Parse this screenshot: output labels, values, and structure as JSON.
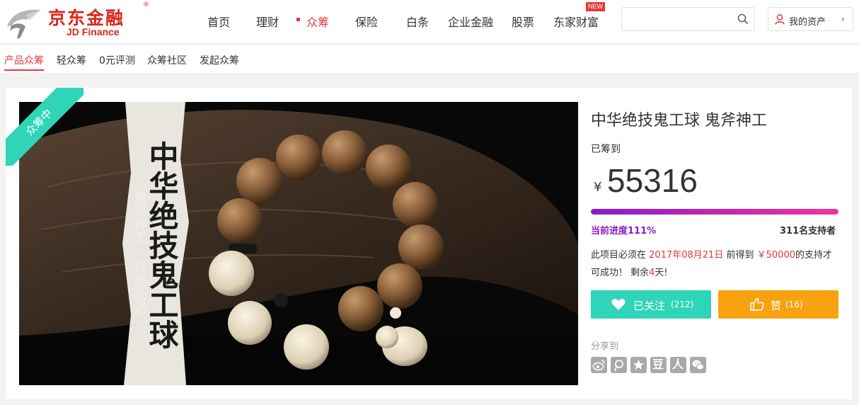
{
  "header": {
    "logo_cn": "京东金融",
    "logo_en": "JD Finance",
    "logo_reg": "®",
    "nav": [
      "首页",
      "理财",
      "众筹",
      "保险",
      "白条",
      "企业金融",
      "股票",
      "东家财富"
    ],
    "active_nav": "众筹",
    "new_badge": "NEW",
    "search": {
      "placeholder": "",
      "value": ""
    },
    "assets_label": "我的资产",
    "assets_chevron": "›"
  },
  "subnav": {
    "items": [
      "产品众筹",
      "轻众筹",
      "0元评测",
      "众筹社区",
      "发起众筹"
    ],
    "active": "产品众筹"
  },
  "project": {
    "status_ribbon": "众筹中",
    "image": {
      "title": "中华绝技鬼工球",
      "subtitle": "鬼斧神工 玲珑剔透"
    },
    "title": "中华绝技鬼工球 鬼斧神工",
    "raised_label": "已筹到",
    "currency": "¥",
    "raised_amount": "55316",
    "progress_percent": 111,
    "progress_text": "当前进度111%",
    "supporters_text": "311名支持者",
    "desc": {
      "part1": "此项目必须在",
      "deadline": "2017年08月21日",
      "part2": "前得到",
      "goal": "￥50000",
      "part3": "的支持才可成功！ 剩余",
      "days_left": "4",
      "part4": "天!"
    },
    "follow": {
      "label": "已关注",
      "count": "(212)"
    },
    "like": {
      "label": "赞",
      "count": "(16)"
    },
    "share": {
      "label": "分享到",
      "icons": [
        "weibo-icon",
        "tencent-weibo-icon",
        "qzone-icon",
        "douban-icon",
        "renren-icon",
        "wechat-icon"
      ],
      "douban_glyph": "豆",
      "renren_glyph": "人"
    }
  },
  "colors": {
    "brand_red": "#e4393c",
    "teal": "#2fd5b8",
    "orange": "#f7a20e",
    "purple": "#8a1cc9",
    "pink": "#f0349b"
  }
}
